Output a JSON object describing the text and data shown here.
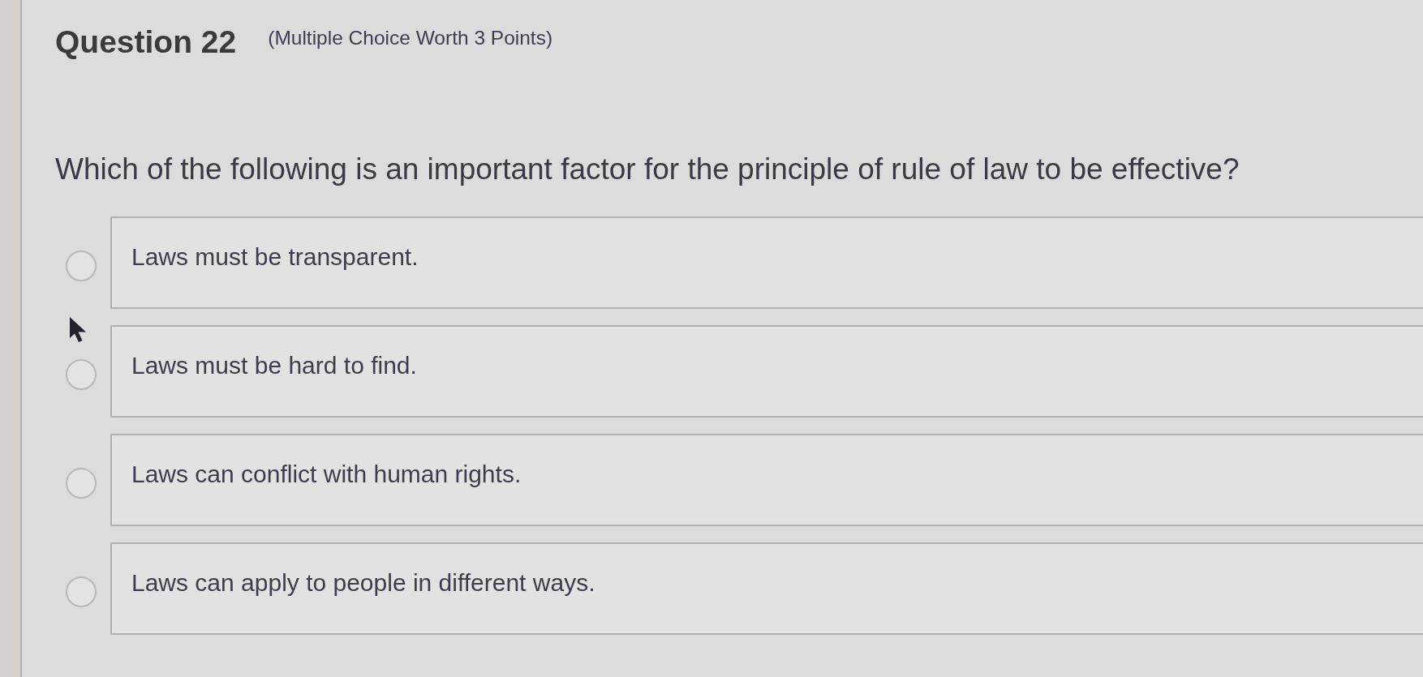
{
  "question": {
    "title": "Question 22",
    "points": "(Multiple Choice Worth 3 Points)",
    "prompt": "Which of the following is an important factor for the principle of rule of law to be effective?"
  },
  "options": [
    {
      "label": "Laws must be transparent.",
      "selected": false
    },
    {
      "label": "Laws must be hard to find.",
      "selected": false
    },
    {
      "label": "Laws can conflict with human rights.",
      "selected": false
    },
    {
      "label": "Laws can apply to people in different ways.",
      "selected": false
    }
  ]
}
